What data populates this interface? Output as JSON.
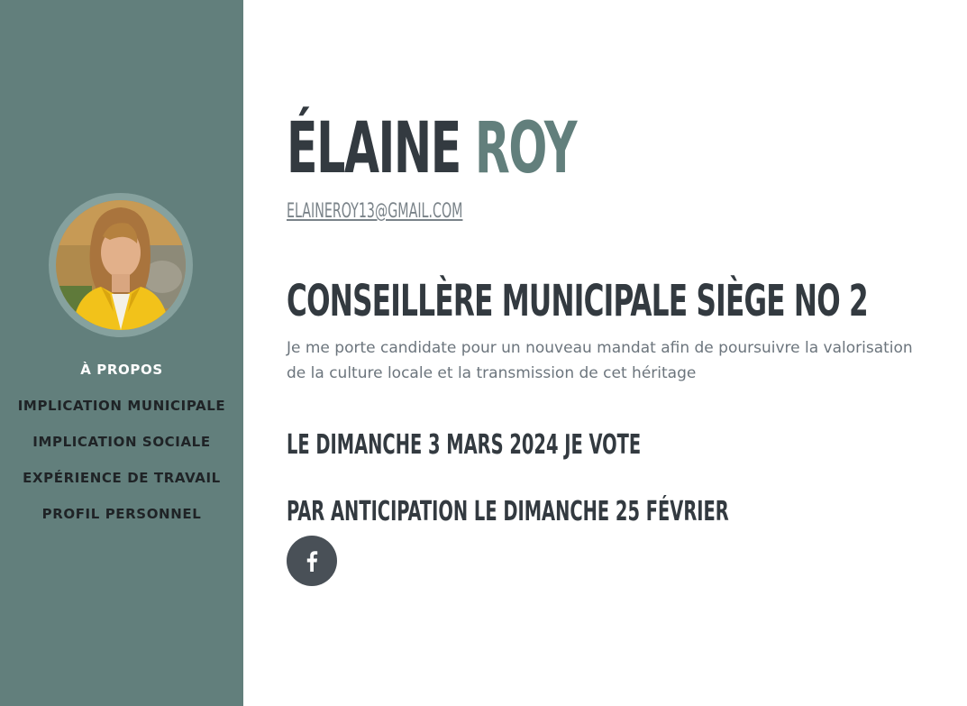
{
  "sidebar": {
    "avatar_alt": "Élaine Roy",
    "nav": [
      {
        "label": "À PROPOS",
        "active": true
      },
      {
        "label": "IMPLICATION MUNICIPALE",
        "active": false
      },
      {
        "label": "IMPLICATION SOCIALE",
        "active": false
      },
      {
        "label": "EXPÉRIENCE DE TRAVAIL",
        "active": false
      },
      {
        "label": "PROFIL PERSONNEL",
        "active": false
      }
    ]
  },
  "main": {
    "first_name": "ÉLAINE",
    "last_name": "ROY",
    "email": "ELAINEROY13@GMAIL.COM",
    "heading": "CONSEILLÈRE MUNICIPALE SIÈGE NO 2",
    "description": "Je me porte candidate pour un nouveau mandat afin de poursuivre la valorisation de la culture locale et la transmission de cet héritage",
    "vote_line_1": "LE DIMANCHE 3 MARS 2024 JE VOTE",
    "vote_line_2": "PAR ANTICIPATION LE DIMANCHE 25 FÉVRIER",
    "social_icon": "facebook-icon"
  },
  "colors": {
    "sidebar_bg": "#627f7c",
    "accent": "#627f7c",
    "heading_text": "#333a40",
    "body_text": "#6c757d",
    "social_bg": "#495057"
  }
}
